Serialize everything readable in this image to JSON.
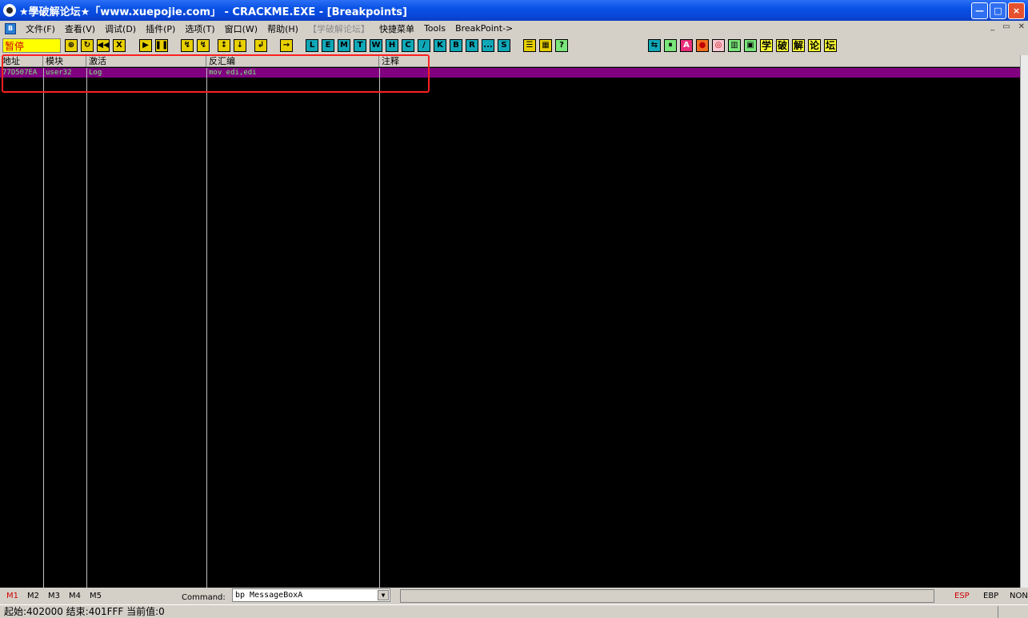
{
  "title": "★學破解论坛★「www.xuepojie.com」 - CRACKME.EXE - [Breakpoints]",
  "window_buttons": {
    "minimize": "—",
    "maximize": "□",
    "close": "×"
  },
  "menu": {
    "items": [
      "文件(F)",
      "查看(V)",
      "调试(D)",
      "插件(P)",
      "选项(T)",
      "窗口(W)",
      "帮助(H)",
      "【学破解论坛】",
      "快捷菜单",
      "Tools",
      "BreakPoint->"
    ],
    "mdi": [
      "_",
      "▭",
      "✕"
    ]
  },
  "toolbar": {
    "status": "暂停",
    "yellow_buttons": [
      "⊕",
      "↻",
      "◀◀",
      "X",
      "▶",
      "❚❚",
      "↯",
      "↯",
      "↕",
      "↓",
      "↲",
      "→"
    ],
    "view_buttons": [
      "L",
      "E",
      "M",
      "T",
      "W",
      "H",
      "C",
      "/",
      "K",
      "B",
      "R",
      "...",
      "S"
    ],
    "misc_buttons": [
      "☰",
      "▦",
      "?"
    ],
    "right_buttons": [
      "⇆",
      "⏸",
      "A",
      "●",
      "◎",
      "▥",
      "▣",
      "学",
      "破",
      "解",
      "论",
      "坛"
    ]
  },
  "breakpoints": {
    "columns": [
      "地址",
      "模块",
      "激活",
      "反汇编",
      "注释"
    ],
    "rows": [
      {
        "address": "77D507EA",
        "module": "user32",
        "active": "Log",
        "disasm": "mov edi,edi",
        "comment": ""
      }
    ]
  },
  "bottom": {
    "markers": [
      "M1",
      "M2",
      "M3",
      "M4",
      "M5"
    ],
    "command_label": "Command:",
    "command_value": "bp MessageBoxA",
    "registers": [
      "ESP",
      "EBP",
      "NONE"
    ]
  },
  "status_line": "起始:402000 结束:401FFF 当前值:0",
  "colors": {
    "row_bg": "#800080",
    "row_text": "#7df07d",
    "list_bg": "#000000",
    "highlight_border": "#ff2020",
    "pause_bg": "#ffff00",
    "pause_text": "#d00000"
  }
}
